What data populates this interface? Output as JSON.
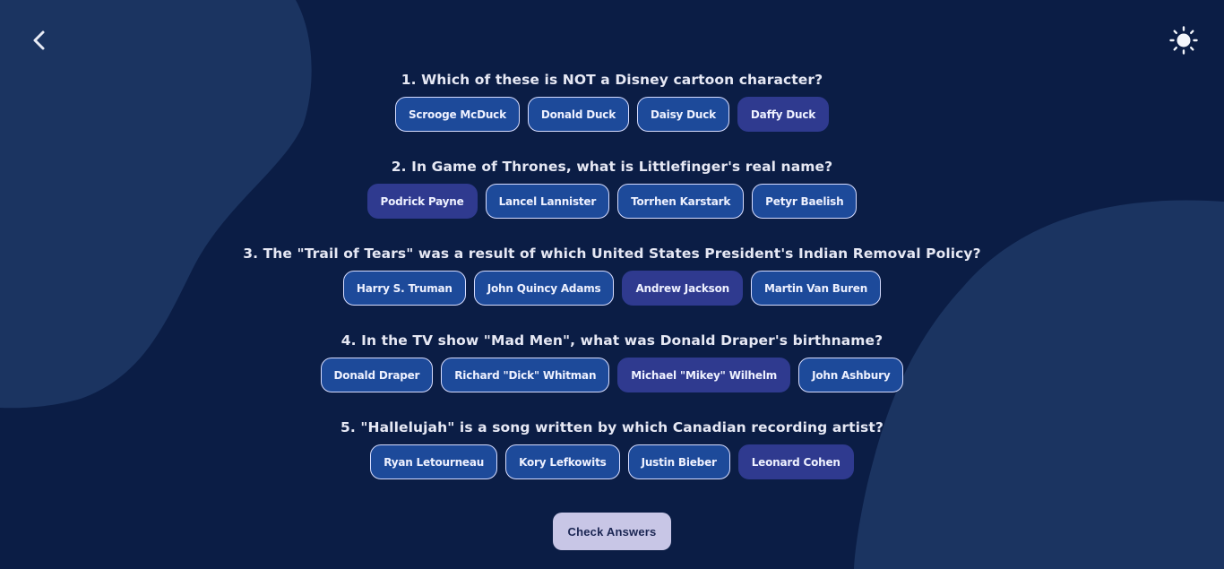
{
  "nav": {
    "back_icon": "chevron-left-icon",
    "theme_icon": "sun-icon"
  },
  "colors": {
    "background": "#0b1d45",
    "blob": "#1b3461",
    "answer": "#1d4a9a",
    "answer_selected": "#2f3a8f",
    "check_button": "#c8c6e6"
  },
  "questions": [
    {
      "text": "1. Which of these is NOT a Disney cartoon character?",
      "answers": [
        "Scrooge McDuck",
        "Donald Duck",
        "Daisy Duck",
        "Daffy Duck"
      ],
      "selected": 3
    },
    {
      "text": "2. In Game of Thrones, what is Littlefinger's real name?",
      "answers": [
        "Podrick Payne",
        "Lancel Lannister",
        "Torrhen Karstark",
        "Petyr Baelish"
      ],
      "selected": 0
    },
    {
      "text": "3. The \"Trail of Tears\" was a result of which United States President's Indian Removal Policy?",
      "answers": [
        "Harry S. Truman",
        "John Quincy Adams",
        "Andrew Jackson",
        "Martin Van Buren"
      ],
      "selected": 2
    },
    {
      "text": "4. In the TV show \"Mad Men\", what was Donald Draper's birthname?",
      "answers": [
        "Donald Draper",
        "Richard \"Dick\" Whitman",
        "Michael \"Mikey\" Wilhelm",
        "John Ashbury"
      ],
      "selected": 2
    },
    {
      "text": "5. \"Hallelujah\" is a song written by which Canadian recording artist?",
      "answers": [
        "Ryan Letourneau",
        "Kory Lefkowits",
        "Justin Bieber",
        "Leonard Cohen"
      ],
      "selected": 3
    }
  ],
  "check_button_label": "Check Answers"
}
